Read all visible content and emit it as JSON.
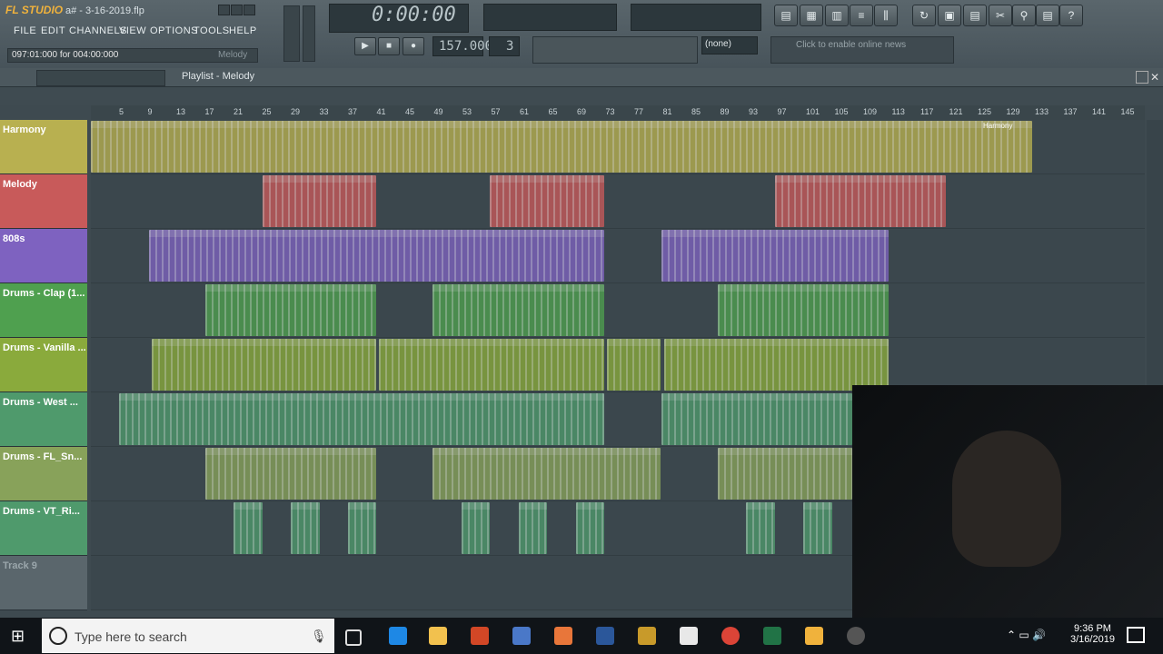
{
  "window": {
    "logo": "FL STUDIO",
    "title": "a# - 3-16-2019.flp"
  },
  "menu": [
    "FILE",
    "EDIT",
    "CHANNELS",
    "VIEW",
    "OPTIONS",
    "TOOLS",
    "HELP"
  ],
  "hint": {
    "text": "097:01:000 for 004:00:000",
    "pattern": "Melody"
  },
  "transport": {
    "time": "0:00:00",
    "tempo": "157.000",
    "pattern": "3",
    "pattern_select": "(none)",
    "news": "Click to enable online news"
  },
  "playlist": {
    "title": "Playlist - Melody",
    "ruler": [
      "5",
      "9",
      "13",
      "17",
      "21",
      "25",
      "29",
      "33",
      "37",
      "41",
      "45",
      "49",
      "53",
      "57",
      "61",
      "65",
      "69",
      "73",
      "77",
      "81",
      "85",
      "89",
      "93",
      "97",
      "101",
      "105",
      "109",
      "113",
      "117",
      "121",
      "125",
      "129",
      "133",
      "137",
      "141",
      "145"
    ]
  },
  "tracks": [
    {
      "name": "Harmony",
      "color": "#b8b050"
    },
    {
      "name": "Melody",
      "color": "#c85a5a"
    },
    {
      "name": "808s",
      "color": "#7e62c0"
    },
    {
      "name": "Drums - Clap (1...",
      "color": "#4fa04f"
    },
    {
      "name": "Drums - Vanilla ...",
      "color": "#8aaa3c"
    },
    {
      "name": "Drums - West ...",
      "color": "#4f9a6c"
    },
    {
      "name": "Drums - FL_Sn...",
      "color": "#88a25a"
    },
    {
      "name": "Drums - VT_Ri...",
      "color": "#4f9a6c"
    },
    {
      "name": "Track 9",
      "color": "#5a666c"
    }
  ],
  "clip_label": "Harmony",
  "taskbar": {
    "search_placeholder": "Type here to search",
    "time": "9:36 PM",
    "date": "3/16/2019"
  }
}
